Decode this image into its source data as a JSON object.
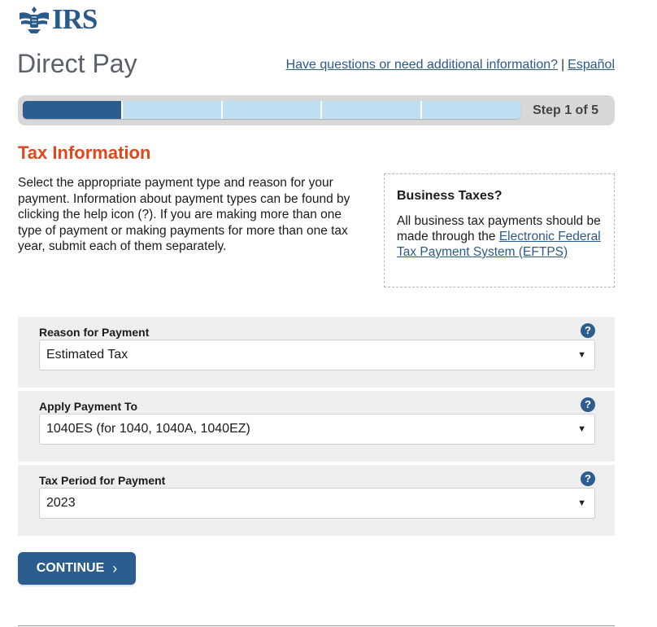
{
  "header": {
    "logo_text": "IRS",
    "app_title": "Direct Pay",
    "help_link": "Have questions or need additional information?",
    "separator": "|",
    "lang_link": "Español"
  },
  "progress": {
    "steps_total": 5,
    "current_step": 1,
    "label": "Step 1 of 5"
  },
  "main": {
    "section_title": "Tax Information",
    "intro": "Select the appropriate payment type and reason for your payment. Information about payment types can be found by clicking the help icon (?). If you are making more than one type of payment or making payments for more than one tax year, submit each of them separately."
  },
  "business_box": {
    "title": "Business Taxes?",
    "text": "All business tax payments should be made through the",
    "link": "Electronic Federal Tax Payment System (EFTPS)"
  },
  "fields": [
    {
      "label": "Reason for Payment",
      "value": "Estimated Tax",
      "help": "?"
    },
    {
      "label": "Apply Payment To",
      "value": "1040ES (for 1040, 1040A, 1040EZ)",
      "help": "?"
    },
    {
      "label": "Tax Period for Payment",
      "value": "2023",
      "help": "?"
    }
  ],
  "actions": {
    "continue_label": "CONTINUE",
    "continue_chevron": "›"
  },
  "icons": {
    "logo": "irs-eagle-icon",
    "help": "question-circle-icon",
    "dropdown": "caret-down-icon"
  },
  "colors": {
    "brand_blue": "#2b5d8e",
    "link_blue": "#2a5a8c",
    "title_orange": "#e1461e",
    "progress_light": "#bfe0f2"
  }
}
